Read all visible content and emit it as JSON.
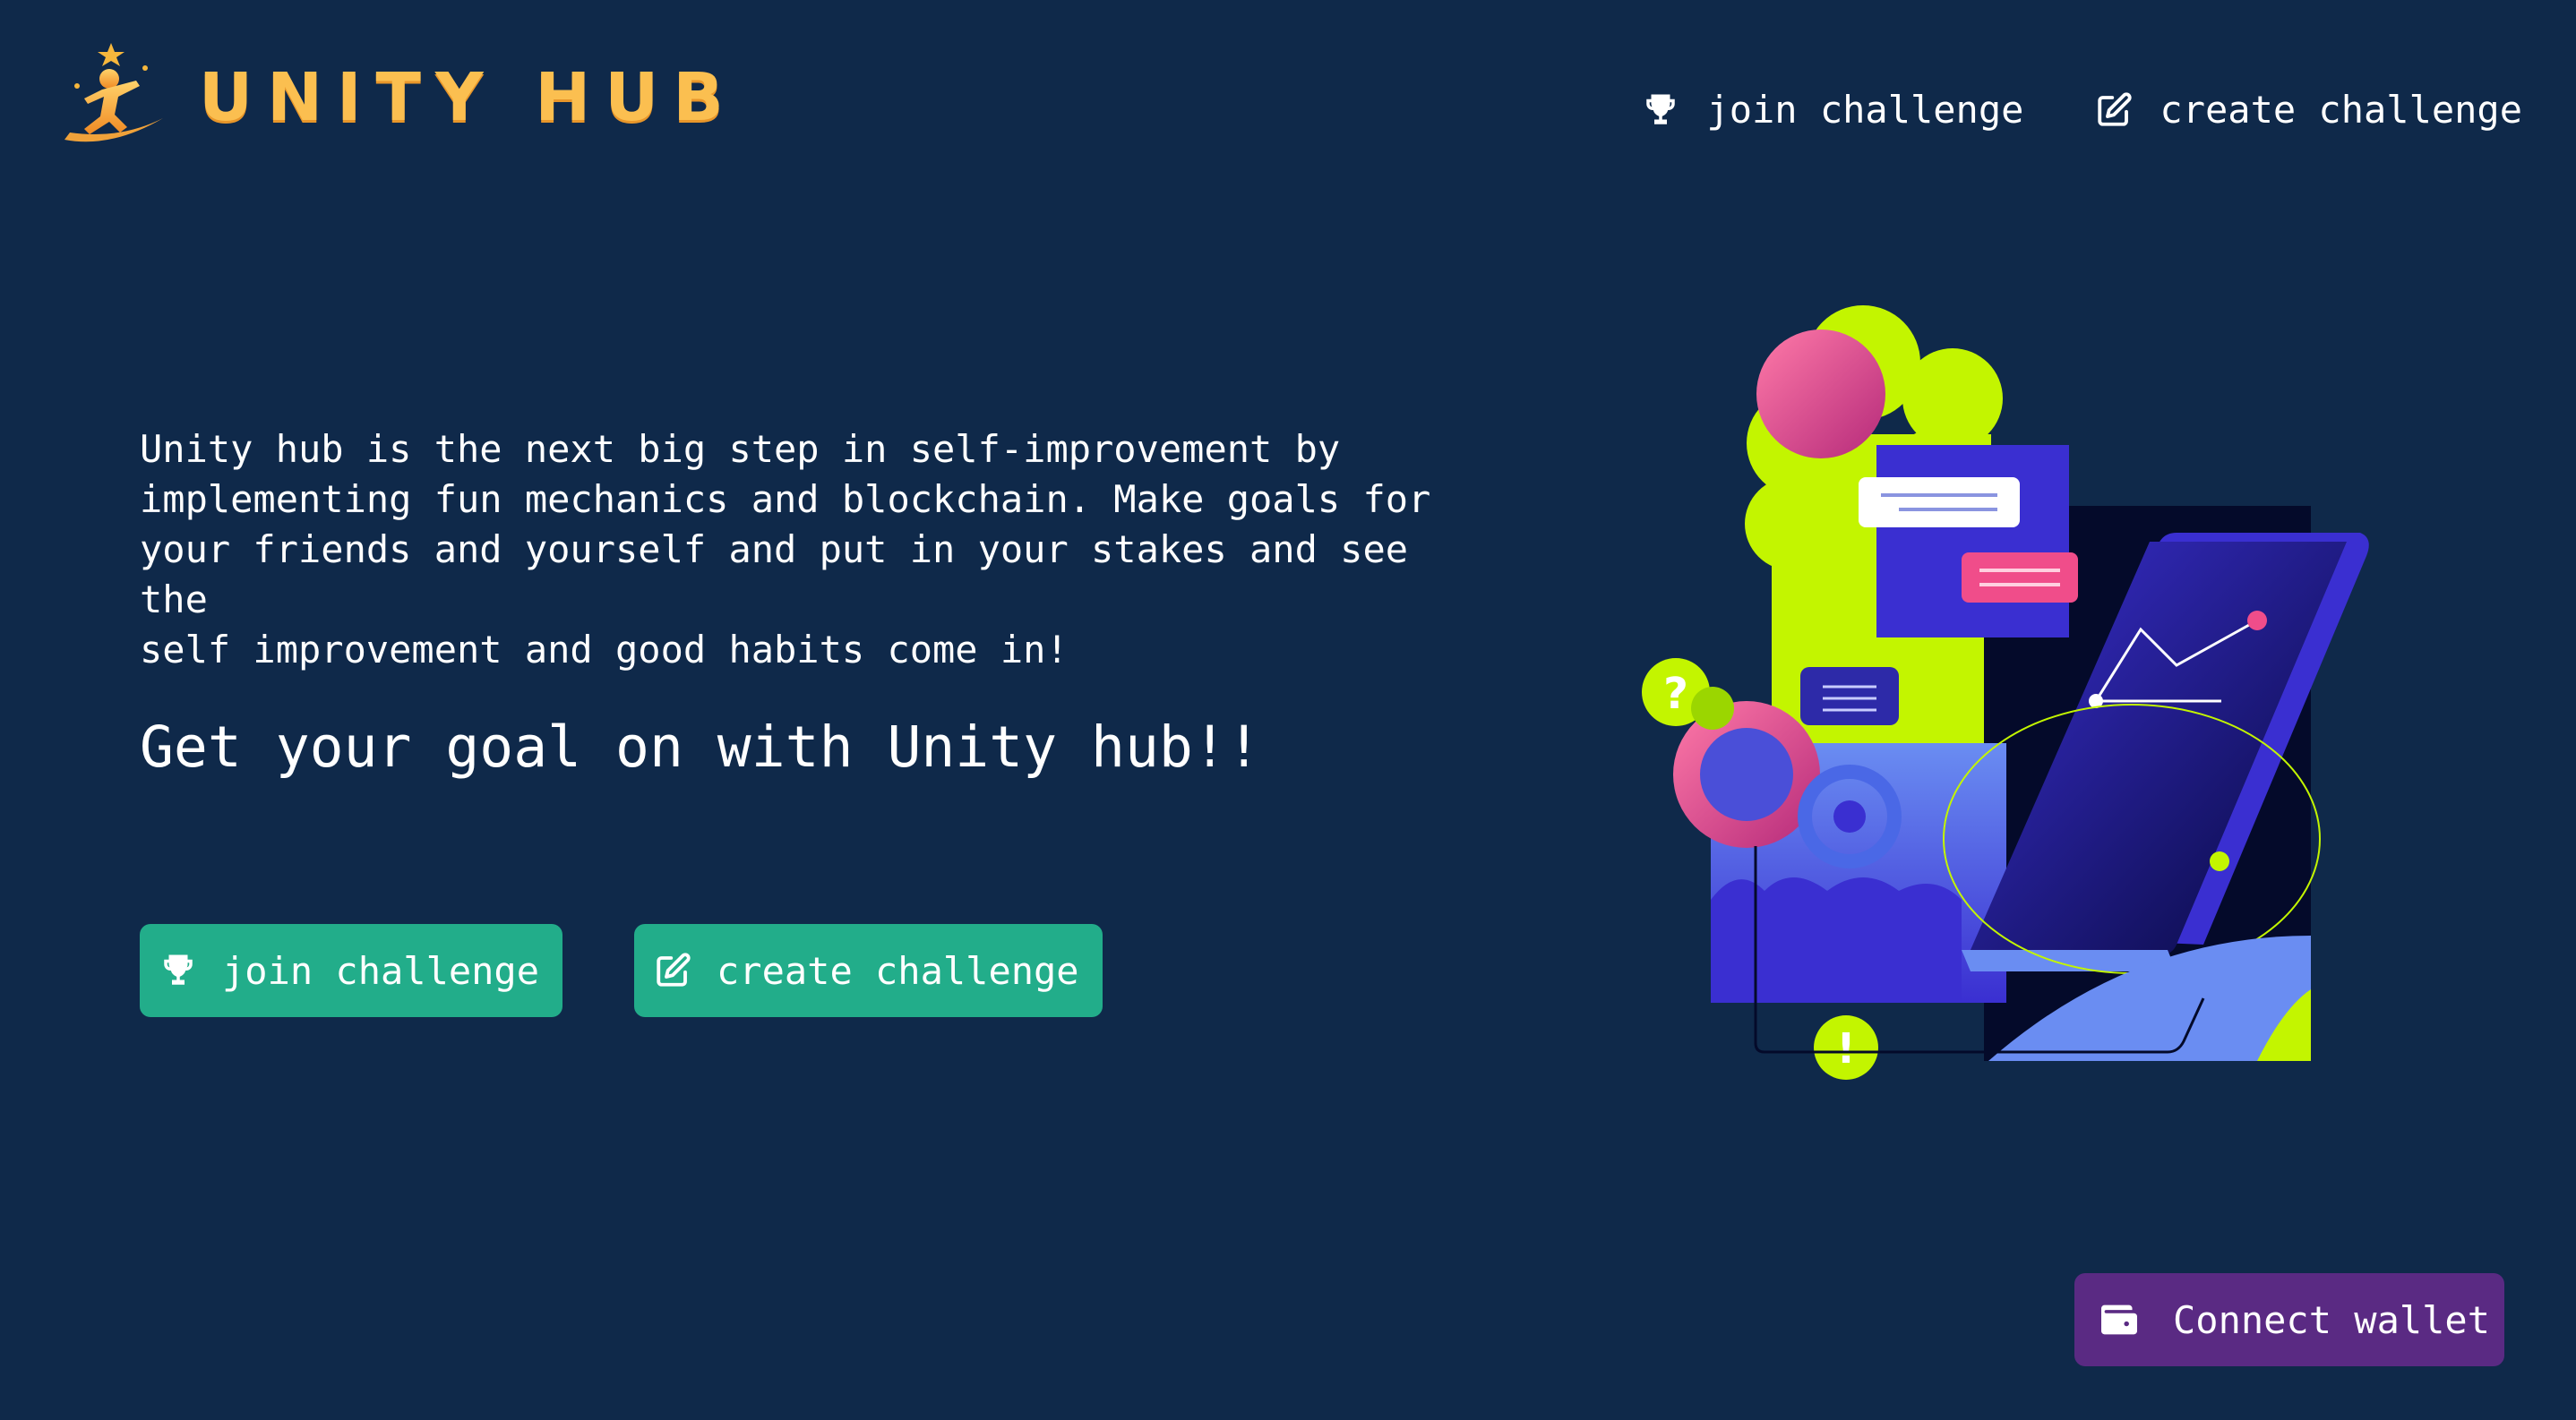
{
  "brand": {
    "name": "UNITY HUB",
    "logo_icon": "star-runner-logo"
  },
  "nav": {
    "join": {
      "label": "join challenge",
      "icon": "trophy-icon"
    },
    "create": {
      "label": "create challenge",
      "icon": "edit-icon"
    }
  },
  "hero": {
    "intro": "Unity hub is the next big step in self-improvement by\nimplementing fun mechanics and blockchain. Make goals for\nyour friends and yourself and put in your stakes and see the\nself improvement and good habits come in!",
    "tagline": "Get your goal on with Unity hub!!",
    "join_button": "join challenge",
    "create_button": "create challenge"
  },
  "wallet": {
    "label": "Connect wallet",
    "icon": "wallet-icon"
  },
  "colors": {
    "background": "#0f294a",
    "brand": "#fbbf50",
    "cta": "#22ad8a",
    "wallet": "#5a2a83",
    "accent_lime": "#c3f500",
    "accent_indigo": "#3a2fd1",
    "accent_pink": "#f04d8a"
  }
}
